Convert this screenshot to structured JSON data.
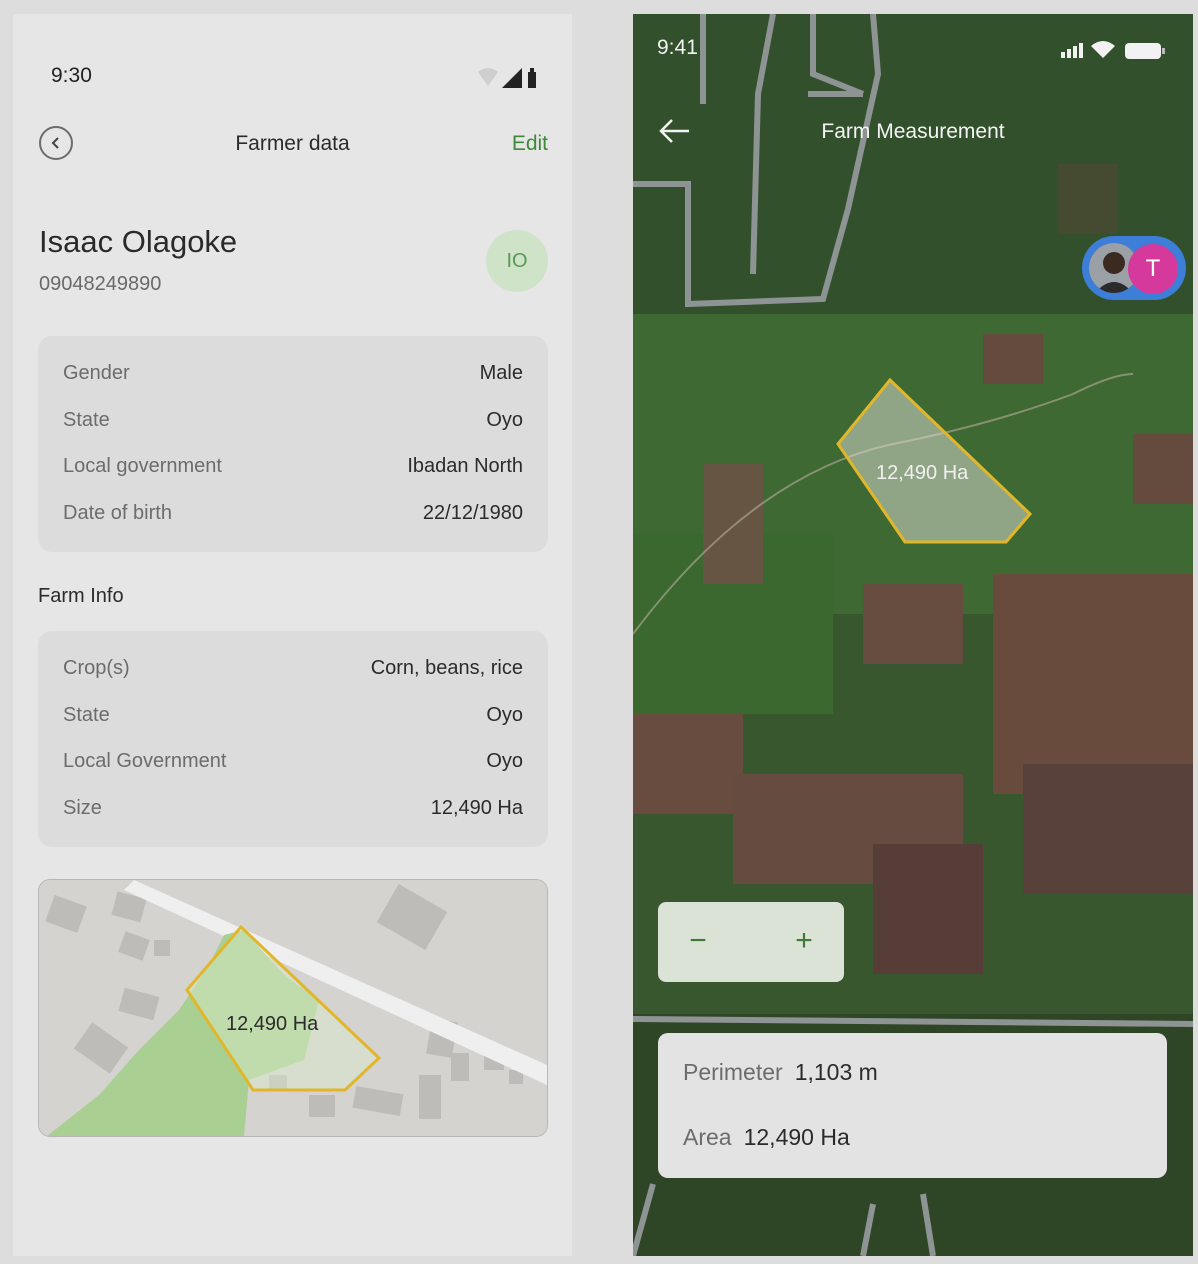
{
  "left_screen": {
    "status": {
      "time": "9:30"
    },
    "nav": {
      "title": "Farmer data",
      "edit_label": "Edit"
    },
    "farmer": {
      "name": "Isaac Olagoke",
      "phone": "09048249890",
      "initials": "IO"
    },
    "personal_info": [
      {
        "label": "Gender",
        "value": "Male"
      },
      {
        "label": "State",
        "value": "Oyo"
      },
      {
        "label": "Local government",
        "value": "Ibadan North"
      },
      {
        "label": "Date of birth",
        "value": "22/12/1980"
      }
    ],
    "farm_section_title": "Farm Info",
    "farm_info": [
      {
        "label": "Crop(s)",
        "value": "Corn, beans, rice"
      },
      {
        "label": "State",
        "value": "Oyo"
      },
      {
        "label": "Local Government",
        "value": "Oyo"
      },
      {
        "label": "Size",
        "value": "12,490 Ha"
      }
    ],
    "map_label": "12,490 Ha"
  },
  "right_screen": {
    "status": {
      "time": "9:41"
    },
    "nav": {
      "title": "Farm Measurement"
    },
    "collaborator_initial": "T",
    "polygon_label": "12,490 Ha",
    "zoom": {
      "minus": "−",
      "plus": "+"
    },
    "measurements": {
      "perimeter_label": "Perimeter",
      "perimeter_value": "1,103 m",
      "area_label": "Area",
      "area_value": "12,490 Ha"
    }
  },
  "colors": {
    "accent_green": "#3f8a3a",
    "polygon_outline": "#e2b62a",
    "avatar_blue": "#3d7ed8",
    "avatar_pink": "#d6399c"
  }
}
